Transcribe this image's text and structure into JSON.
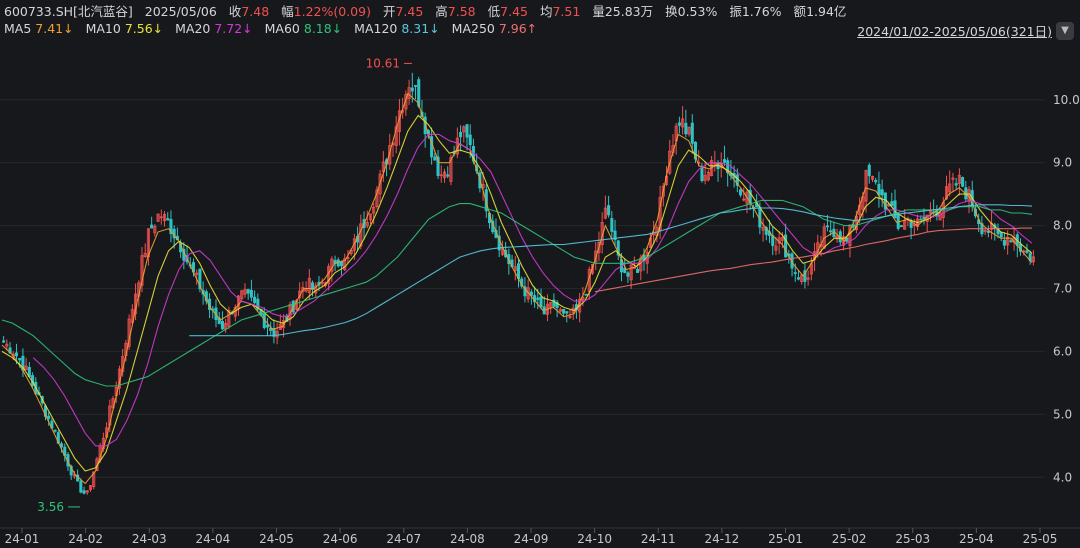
{
  "header": {
    "code": "600733.SH[北汽蓝谷]",
    "date": "2025/05/06",
    "close_label": "收",
    "close_value": "7.48",
    "chg_label": "幅",
    "chg_value": "1.22%(0.09)",
    "open_label": "开",
    "open_value": "7.45",
    "high_label": "高",
    "high_value": "7.58",
    "low_label": "低",
    "low_value": "7.45",
    "avg_label": "均",
    "avg_value": "7.51",
    "vol_label": "量",
    "vol_value": "25.83万",
    "turn_label": "换",
    "turn_value": "0.53%",
    "amp_label": "振",
    "amp_value": "1.76%",
    "amt_label": "额",
    "amt_value": "1.94亿"
  },
  "ma_legend": [
    {
      "name": "MA5",
      "value": "7.41↓",
      "color": "#f0a030"
    },
    {
      "name": "MA10",
      "value": "7.56↓",
      "color": "#e8e23a"
    },
    {
      "name": "MA20",
      "value": "7.72↓",
      "color": "#d23ad2"
    },
    {
      "name": "MA60",
      "value": "8.18↓",
      "color": "#2fc37a"
    },
    {
      "name": "MA120",
      "value": "8.31↓",
      "color": "#57c9e0"
    },
    {
      "name": "MA250",
      "value": "7.96↑",
      "color": "#f07070"
    }
  ],
  "range_text": "2024/01/02-2025/05/06(321日)",
  "range_button_icon": "chevron-down-icon",
  "colors": {
    "up": "#f0514f",
    "down": "#2fc3c3",
    "background": "#17181c"
  },
  "chart_data": {
    "type": "candlestick",
    "y_ticks": [
      "4.0",
      "5.0",
      "6.0",
      "7.0",
      "8.0",
      "9.0",
      "10.0"
    ],
    "ylim": [
      3.4,
      10.95
    ],
    "x_ticks": [
      "24-01",
      "24-02",
      "24-03",
      "24-04",
      "24-05",
      "24-06",
      "24-07",
      "24-08",
      "24-09",
      "24-10",
      "24-11",
      "24-12",
      "25-01",
      "25-02",
      "25-03",
      "25-04",
      "25-05"
    ],
    "annotations": [
      {
        "text": "10.61",
        "value": 10.61,
        "type": "high",
        "color": "#f0514f"
      },
      {
        "text": "3.56",
        "value": 3.56,
        "type": "low",
        "color": "#2fc37a"
      }
    ],
    "close_path": [
      6.15,
      6.0,
      5.75,
      5.4,
      5.05,
      4.7,
      4.3,
      3.9,
      3.7,
      4.3,
      4.9,
      5.6,
      6.4,
      7.2,
      7.9,
      8.2,
      8.0,
      7.7,
      7.3,
      7.0,
      6.6,
      6.4,
      6.7,
      6.9,
      6.75,
      6.5,
      6.3,
      6.45,
      6.8,
      7.1,
      6.95,
      7.2,
      7.5,
      7.4,
      7.8,
      8.2,
      8.6,
      9.2,
      9.8,
      10.3,
      10.0,
      9.3,
      8.8,
      9.0,
      9.5,
      9.2,
      8.6,
      8.0,
      7.6,
      7.3,
      7.0,
      6.8,
      6.6,
      6.75,
      6.5,
      6.6,
      7.0,
      7.6,
      8.3,
      7.5,
      7.2,
      7.35,
      7.7,
      8.2,
      9.2,
      9.7,
      9.4,
      8.8,
      8.9,
      9.1,
      8.8,
      8.6,
      8.3,
      8.0,
      7.8,
      7.7,
      7.3,
      7.1,
      7.5,
      7.9,
      7.95,
      7.7,
      8.2,
      8.8,
      8.6,
      8.3,
      8.0,
      8.1,
      8.0,
      8.2,
      8.3,
      8.6,
      8.7,
      8.4,
      8.0,
      7.9,
      7.8,
      7.85,
      7.6,
      7.48
    ],
    "ma_lines": [
      {
        "name": "MA5",
        "values": [
          6.1,
          5.95,
          5.7,
          5.4,
          5.05,
          4.7,
          4.35,
          4.05,
          3.9,
          4.1,
          4.6,
          5.3,
          6.0,
          6.8,
          7.5,
          7.9,
          7.95,
          7.75,
          7.4,
          7.05,
          6.7,
          6.5,
          6.6,
          6.8,
          6.75,
          6.55,
          6.35,
          6.4,
          6.7,
          7.0,
          7.0,
          7.15,
          7.4,
          7.45,
          7.75,
          8.1,
          8.5,
          9.0,
          9.6,
          10.1,
          9.95,
          9.45,
          9.0,
          9.0,
          9.3,
          9.2,
          8.7,
          8.1,
          7.7,
          7.35,
          7.05,
          6.85,
          6.65,
          6.7,
          6.55,
          6.6,
          6.95,
          7.45,
          8.0,
          7.65,
          7.3,
          7.35,
          7.65,
          8.1,
          8.9,
          9.45,
          9.35,
          8.95,
          8.9,
          9.0,
          8.8,
          8.6,
          8.35,
          8.05,
          7.85,
          7.7,
          7.4,
          7.2,
          7.45,
          7.8,
          7.9,
          7.75,
          8.1,
          8.6,
          8.55,
          8.3,
          8.05,
          8.1,
          8.0,
          8.15,
          8.25,
          8.5,
          8.6,
          8.45,
          8.05,
          7.9,
          7.8,
          7.8,
          7.6,
          7.41
        ]
      },
      {
        "name": "MA10",
        "values": [
          6.0,
          5.9,
          5.75,
          5.5,
          5.2,
          4.9,
          4.6,
          4.3,
          4.1,
          4.15,
          4.4,
          4.9,
          5.4,
          6.0,
          6.6,
          7.2,
          7.6,
          7.75,
          7.65,
          7.4,
          7.05,
          6.75,
          6.6,
          6.7,
          6.75,
          6.65,
          6.5,
          6.45,
          6.55,
          6.8,
          6.95,
          7.05,
          7.25,
          7.35,
          7.55,
          7.85,
          8.2,
          8.6,
          9.05,
          9.5,
          9.75,
          9.6,
          9.35,
          9.15,
          9.2,
          9.15,
          8.9,
          8.5,
          8.05,
          7.7,
          7.35,
          7.05,
          6.85,
          6.8,
          6.7,
          6.65,
          6.8,
          7.1,
          7.5,
          7.6,
          7.45,
          7.35,
          7.5,
          7.85,
          8.4,
          8.95,
          9.2,
          9.1,
          8.95,
          8.95,
          8.85,
          8.7,
          8.5,
          8.25,
          8.0,
          7.85,
          7.6,
          7.4,
          7.45,
          7.65,
          7.8,
          7.8,
          7.95,
          8.3,
          8.45,
          8.4,
          8.2,
          8.1,
          8.05,
          8.1,
          8.2,
          8.35,
          8.5,
          8.5,
          8.25,
          8.05,
          7.9,
          7.85,
          7.7,
          7.56
        ]
      },
      {
        "name": "MA20",
        "values": [
          null,
          null,
          null,
          5.9,
          5.75,
          5.55,
          5.3,
          5.0,
          4.7,
          4.5,
          4.5,
          4.6,
          4.9,
          5.3,
          5.8,
          6.4,
          6.9,
          7.3,
          7.55,
          7.6,
          7.45,
          7.2,
          6.95,
          6.8,
          6.75,
          6.7,
          6.6,
          6.55,
          6.6,
          6.7,
          6.8,
          6.95,
          7.1,
          7.25,
          7.4,
          7.6,
          7.85,
          8.15,
          8.5,
          8.9,
          9.25,
          9.45,
          9.45,
          9.35,
          9.3,
          9.2,
          9.05,
          8.85,
          8.5,
          8.15,
          7.8,
          7.5,
          7.25,
          7.05,
          6.9,
          6.8,
          6.8,
          6.9,
          7.1,
          7.3,
          7.4,
          7.4,
          7.45,
          7.65,
          7.95,
          8.35,
          8.7,
          8.9,
          9.0,
          9.0,
          8.95,
          8.8,
          8.65,
          8.45,
          8.25,
          8.05,
          7.85,
          7.65,
          7.55,
          7.55,
          7.65,
          7.7,
          7.8,
          8.0,
          8.15,
          8.25,
          8.25,
          8.2,
          8.15,
          8.15,
          8.15,
          8.25,
          8.35,
          8.4,
          8.35,
          8.25,
          8.1,
          8.0,
          7.85,
          7.72
        ]
      },
      {
        "name": "MA60",
        "values": [
          6.5,
          6.45,
          6.35,
          6.25,
          6.1,
          5.95,
          5.8,
          5.65,
          5.55,
          5.5,
          5.45,
          5.45,
          5.5,
          5.55,
          5.6,
          5.7,
          5.8,
          5.9,
          6.0,
          6.1,
          6.2,
          6.3,
          6.4,
          6.5,
          6.55,
          6.6,
          6.65,
          6.7,
          6.75,
          6.8,
          6.85,
          6.9,
          6.95,
          7.0,
          7.05,
          7.1,
          7.2,
          7.35,
          7.5,
          7.7,
          7.9,
          8.1,
          8.2,
          8.3,
          8.35,
          8.35,
          8.3,
          8.25,
          8.2,
          8.1,
          8.0,
          7.9,
          7.8,
          7.7,
          7.6,
          7.5,
          7.45,
          7.4,
          7.4,
          7.4,
          7.4,
          7.45,
          7.5,
          7.6,
          7.7,
          7.8,
          7.9,
          8.0,
          8.1,
          8.2,
          8.25,
          8.3,
          8.35,
          8.4,
          8.4,
          8.4,
          8.35,
          8.3,
          8.2,
          8.1,
          8.05,
          8.0,
          8.0,
          8.05,
          8.1,
          8.15,
          8.2,
          8.25,
          8.25,
          8.25,
          8.25,
          8.25,
          8.3,
          8.3,
          8.3,
          8.25,
          8.25,
          8.2,
          8.2,
          8.18
        ]
      },
      {
        "name": "MA120",
        "values": [
          null,
          null,
          null,
          null,
          null,
          null,
          null,
          null,
          null,
          null,
          null,
          null,
          null,
          null,
          null,
          null,
          null,
          null,
          6.25,
          6.25,
          6.25,
          6.25,
          6.25,
          6.25,
          6.25,
          6.25,
          6.25,
          6.27,
          6.3,
          6.33,
          6.35,
          6.38,
          6.42,
          6.46,
          6.52,
          6.6,
          6.7,
          6.8,
          6.9,
          7.0,
          7.1,
          7.2,
          7.3,
          7.4,
          7.5,
          7.55,
          7.6,
          7.63,
          7.65,
          7.66,
          7.67,
          7.68,
          7.69,
          7.7,
          7.7,
          7.72,
          7.74,
          7.76,
          7.78,
          7.8,
          7.82,
          7.84,
          7.86,
          7.9,
          7.95,
          8.0,
          8.05,
          8.1,
          8.15,
          8.2,
          8.22,
          8.25,
          8.27,
          8.28,
          8.28,
          8.27,
          8.25,
          8.22,
          8.18,
          8.15,
          8.12,
          8.1,
          8.08,
          8.1,
          8.12,
          8.15,
          8.18,
          8.2,
          8.22,
          8.24,
          8.26,
          8.28,
          8.3,
          8.32,
          8.33,
          8.33,
          8.33,
          8.32,
          8.32,
          8.31
        ]
      },
      {
        "name": "MA250",
        "values": [
          null,
          null,
          null,
          null,
          null,
          null,
          null,
          null,
          null,
          null,
          null,
          null,
          null,
          null,
          null,
          null,
          null,
          null,
          null,
          null,
          null,
          null,
          null,
          null,
          null,
          null,
          null,
          null,
          null,
          null,
          null,
          null,
          null,
          null,
          null,
          null,
          null,
          null,
          null,
          null,
          null,
          null,
          null,
          null,
          null,
          null,
          null,
          null,
          null,
          null,
          null,
          null,
          null,
          null,
          null,
          null,
          null,
          6.95,
          6.98,
          7.01,
          7.04,
          7.07,
          7.1,
          7.13,
          7.16,
          7.19,
          7.22,
          7.25,
          7.28,
          7.3,
          7.32,
          7.35,
          7.38,
          7.4,
          7.42,
          7.45,
          7.48,
          7.5,
          7.53,
          7.56,
          7.6,
          7.63,
          7.66,
          7.7,
          7.73,
          7.76,
          7.8,
          7.83,
          7.86,
          7.9,
          7.92,
          7.93,
          7.94,
          7.95,
          7.95,
          7.95,
          7.95,
          7.95,
          7.96,
          7.96
        ]
      }
    ]
  }
}
